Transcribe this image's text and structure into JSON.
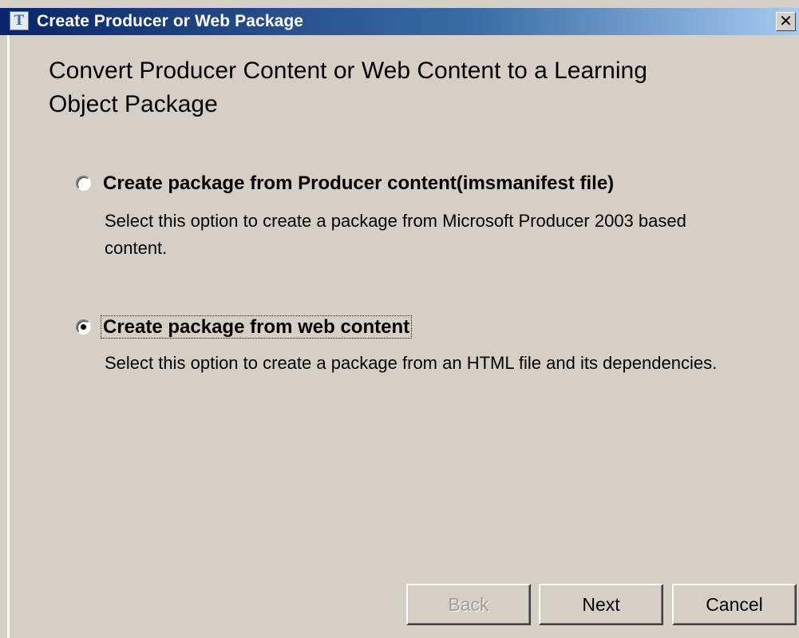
{
  "window": {
    "title": "Create Producer or Web Package",
    "icon_glyph": "T",
    "close_glyph": "✕"
  },
  "page": {
    "title": "Convert Producer Content or Web Content to a Learning Object Package"
  },
  "options": [
    {
      "label": "Create package from Producer content(imsmanifest file)",
      "description": "Select this option to create a package from Microsoft Producer 2003 based content.",
      "selected": false
    },
    {
      "label": "Create package from web content",
      "description": "Select this option to create a package from an HTML file and its dependencies.",
      "selected": true
    }
  ],
  "buttons": {
    "back": "Back",
    "next": "Next",
    "cancel": "Cancel"
  },
  "colors": {
    "titlebar_start": "#0a246a",
    "titlebar_end": "#a6caf0",
    "dialog_bg": "#d4d0c8"
  }
}
